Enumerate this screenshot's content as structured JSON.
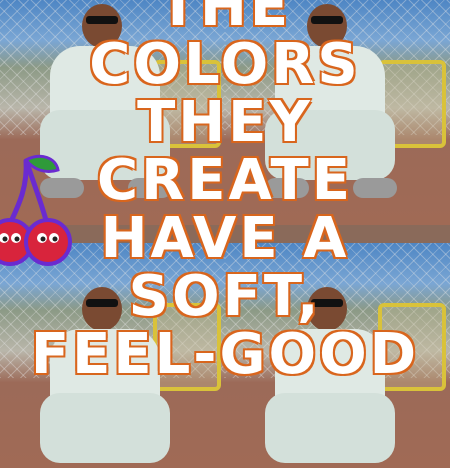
{
  "headline": {
    "lines": [
      "THE",
      "COLORS",
      "THEY",
      "CREATE",
      "HAVE A",
      "SOFT,",
      "FEEL-GOOD"
    ]
  },
  "colors": {
    "text_fill": "#ffffff",
    "text_outline": "#d9661e",
    "cherry": "#d8243c",
    "cherry_outline": "#6a2bd0"
  },
  "icons": {
    "sticker": "cherry-sticker-icon"
  }
}
